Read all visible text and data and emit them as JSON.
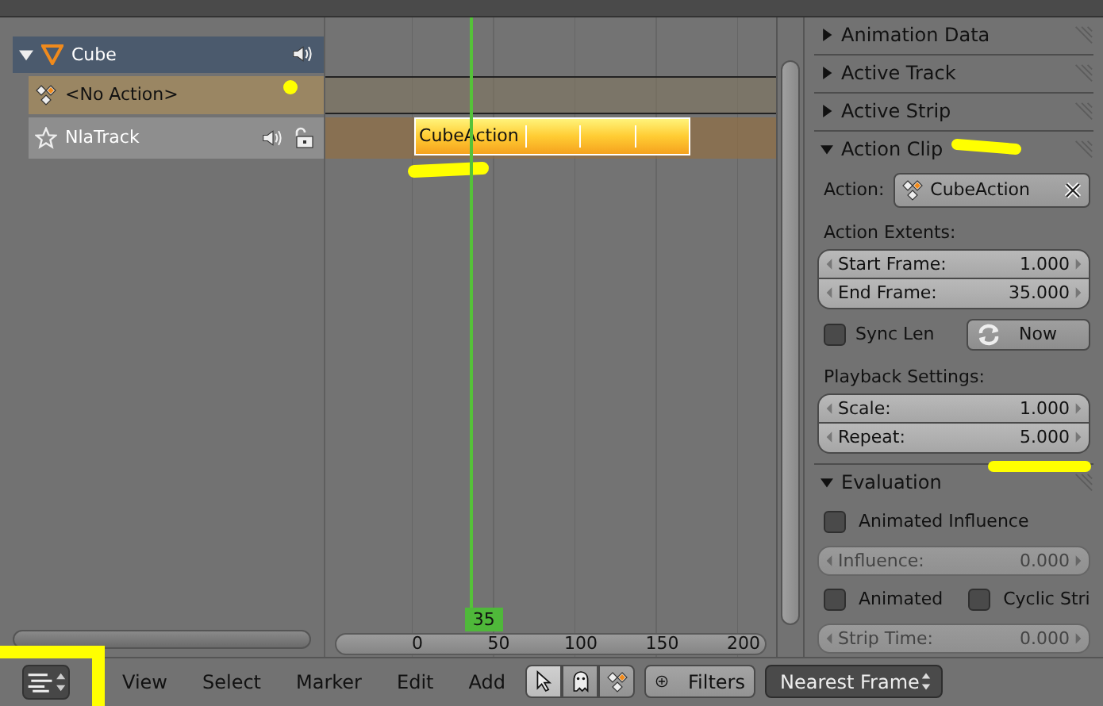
{
  "channels": [
    {
      "name": "Cube",
      "kind": "object",
      "expanded": true
    },
    {
      "name": "<No Action>",
      "kind": "action"
    },
    {
      "name": "NlaTrack",
      "kind": "track",
      "strips": [
        {
          "label": "CubeAction"
        }
      ]
    }
  ],
  "timeline": {
    "current_frame": "35",
    "ruler_labels": [
      "0",
      "50",
      "100",
      "150",
      "200"
    ]
  },
  "panel": {
    "sections": [
      {
        "title": "Animation Data",
        "expanded": false
      },
      {
        "title": "Active Track",
        "expanded": false
      },
      {
        "title": "Active Strip",
        "expanded": false
      },
      {
        "title": "Action Clip",
        "expanded": true,
        "items": [
          {
            "kind": "picker",
            "label": "Action:",
            "value": "CubeAction"
          },
          {
            "kind": "heading",
            "text": "Action Extents:"
          },
          {
            "kind": "numbers",
            "disabled": false,
            "fields": [
              {
                "label": "Start Frame:",
                "value": "1.000"
              },
              {
                "label": "End Frame:",
                "value": "35.000"
              }
            ]
          },
          {
            "kind": "sync",
            "label": "Sync Len",
            "checked": false,
            "button": "Now"
          },
          {
            "kind": "heading",
            "text": "Playback Settings:"
          },
          {
            "kind": "numbers",
            "disabled": false,
            "fields": [
              {
                "label": "Scale:",
                "value": "1.000"
              },
              {
                "label": "Repeat:",
                "value": "5.000"
              }
            ]
          }
        ]
      },
      {
        "title": "Evaluation",
        "expanded": true,
        "items": [
          {
            "kind": "checks",
            "checks": [
              {
                "label": "Animated Influence",
                "checked": false
              }
            ]
          },
          {
            "kind": "numbers",
            "disabled": true,
            "fields": [
              {
                "label": "Influence:",
                "value": "0.000"
              }
            ]
          },
          {
            "kind": "checks",
            "checks": [
              {
                "label": "Animated",
                "checked": false
              },
              {
                "label": "Cyclic Stri",
                "checked": false
              }
            ]
          },
          {
            "kind": "numbers",
            "disabled": true,
            "fields": [
              {
                "label": "Strip Time:",
                "value": "0.000"
              }
            ]
          }
        ]
      }
    ]
  },
  "header": {
    "menus": [
      "View",
      "Select",
      "Marker",
      "Edit",
      "Add"
    ],
    "tools": [
      {
        "kind": "cursor",
        "selected": true
      },
      {
        "kind": "ghost",
        "selected": false
      },
      {
        "kind": "action",
        "selected": false
      }
    ],
    "filters": "Filters",
    "snap": "Nearest Frame"
  }
}
